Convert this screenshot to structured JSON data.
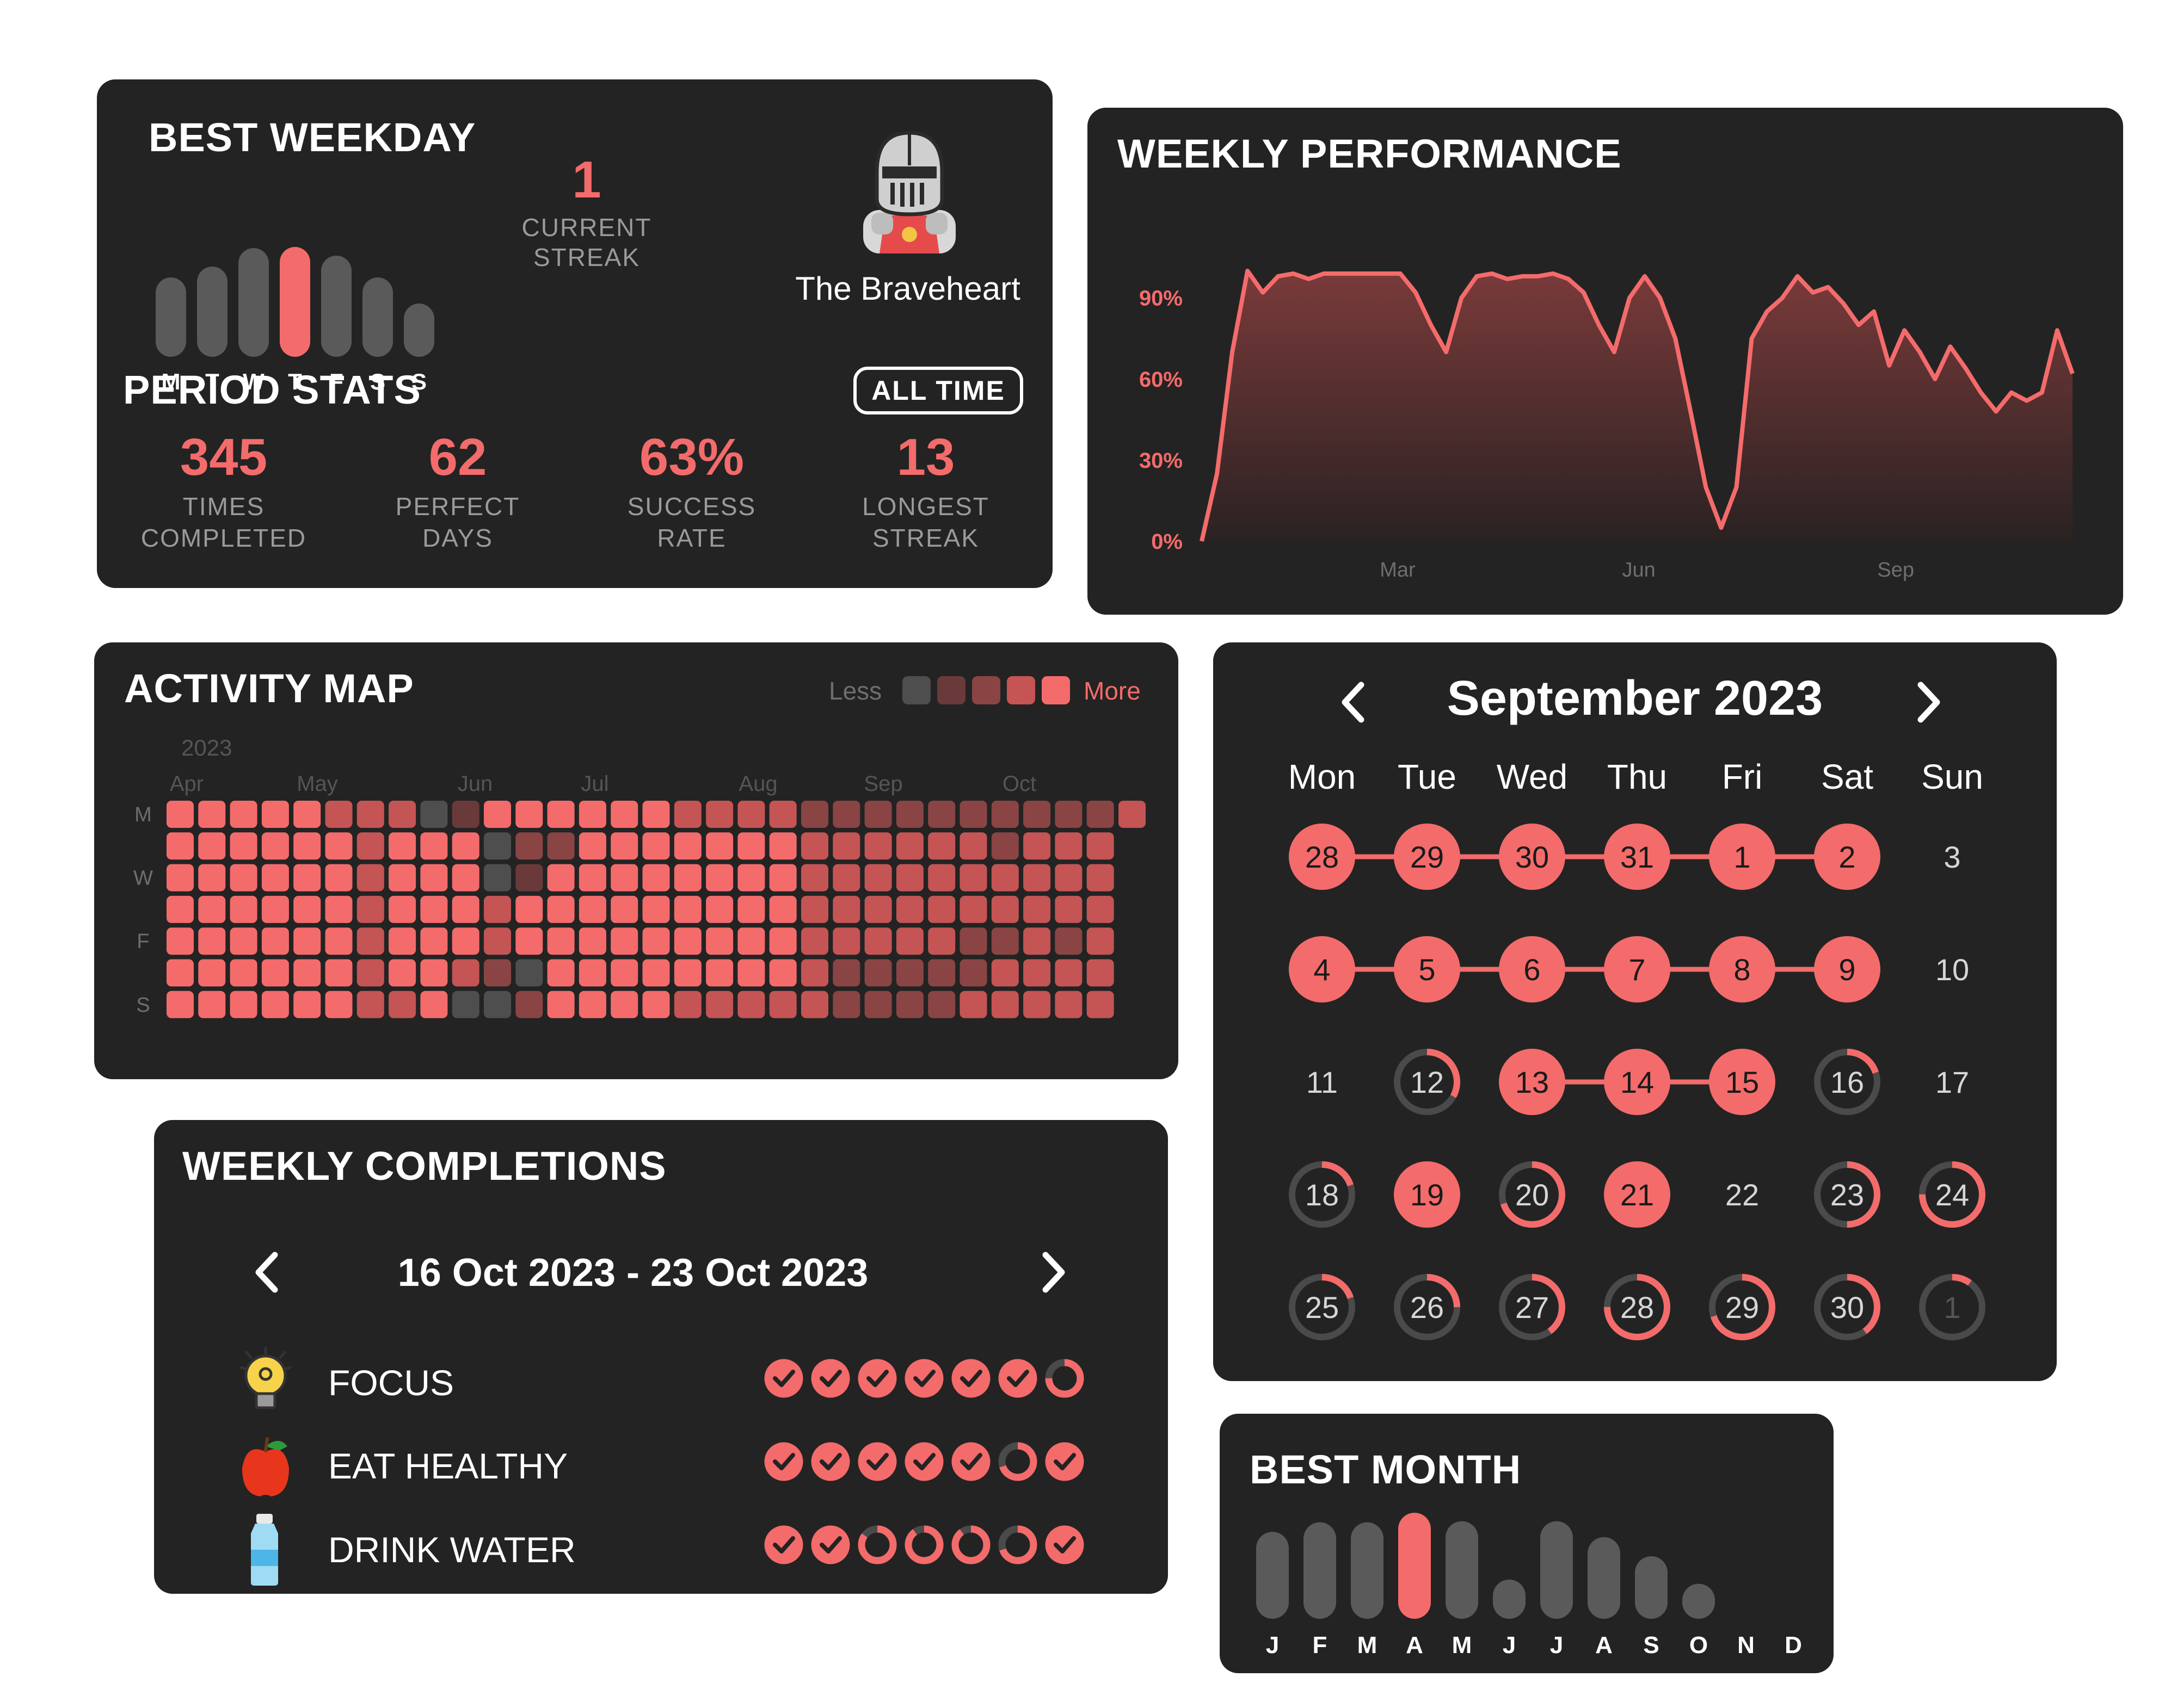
{
  "colors": {
    "accent": "#f46b6b",
    "card": "#232323",
    "bar_gray": "#5a5a5a",
    "muted": "#9a9a9a"
  },
  "best_weekday": {
    "title": "BEST WEEKDAY",
    "days": [
      "M",
      "T",
      "W",
      "T",
      "F",
      "S",
      "S"
    ],
    "values": [
      0.58,
      0.68,
      0.85,
      0.86,
      0.78,
      0.58,
      0.34
    ],
    "best_index": 3
  },
  "streak": {
    "value": "1",
    "label_line1": "CURRENT",
    "label_line2": "STREAK"
  },
  "avatar": {
    "icon": "knight-helmet-icon",
    "name": "The Braveheart"
  },
  "period_stats": {
    "title": "PERIOD STATS",
    "filter": "ALL TIME",
    "stats": [
      {
        "value": "345",
        "line1": "TIMES",
        "line2": "COMPLETED"
      },
      {
        "value": "62",
        "line1": "PERFECT",
        "line2": "DAYS"
      },
      {
        "value": "63%",
        "line1": "SUCCESS",
        "line2": "RATE"
      },
      {
        "value": "13",
        "line1": "LONGEST",
        "line2": "STREAK"
      }
    ]
  },
  "weekly_performance": {
    "title": "WEEKLY PERFORMANCE",
    "chart_data": {
      "type": "area",
      "y_ticks": [
        "90%",
        "60%",
        "30%",
        "0%"
      ],
      "x_ticks": [
        "Mar",
        "Jun",
        "Sep"
      ],
      "ylim": [
        0,
        100
      ],
      "values": [
        0,
        25,
        70,
        100,
        92,
        98,
        99,
        97,
        99,
        99,
        99,
        99,
        99,
        99,
        92,
        80,
        70,
        90,
        98,
        99,
        97,
        98,
        98,
        99,
        97,
        92,
        80,
        70,
        90,
        98,
        90,
        75,
        48,
        20,
        5,
        20,
        75,
        85,
        90,
        98,
        92,
        94,
        88,
        80,
        85,
        65,
        78,
        70,
        60,
        72,
        64,
        55,
        48,
        55,
        52,
        55,
        78,
        62
      ]
    }
  },
  "activity_map": {
    "title": "ACTIVITY MAP",
    "legend_less": "Less",
    "legend_more": "More",
    "year": "2023",
    "months": [
      "Apr",
      "May",
      "Jun",
      "Jul",
      "Aug",
      "Sep",
      "Oct"
    ],
    "day_labels": [
      "M",
      "",
      "W",
      "",
      "F",
      "",
      "S"
    ],
    "rows": [
      "4444433301444444333322222222223",
      "444444344402244444443333332333",
      "444444344401444444443333333333",
      "444444344434444444443333333333",
      "444444344434444444443333322323",
      "444444344320444444443222223333",
      "444444334002444433333222233333"
    ]
  },
  "calendar": {
    "month": "September 2023",
    "weekdays": [
      "Mon",
      "Tue",
      "Wed",
      "Thu",
      "Fri",
      "Sat",
      "Sun"
    ],
    "weeks": [
      [
        {
          "d": "28",
          "p": 1
        },
        {
          "d": "29",
          "p": 1
        },
        {
          "d": "30",
          "p": 1
        },
        {
          "d": "31",
          "p": 1
        },
        {
          "d": "1",
          "p": 1
        },
        {
          "d": "2",
          "p": 1
        },
        {
          "d": "3",
          "p": 0
        }
      ],
      [
        {
          "d": "4",
          "p": 1
        },
        {
          "d": "5",
          "p": 1
        },
        {
          "d": "6",
          "p": 1
        },
        {
          "d": "7",
          "p": 1
        },
        {
          "d": "8",
          "p": 1
        },
        {
          "d": "9",
          "p": 1
        },
        {
          "d": "10",
          "p": 0
        }
      ],
      [
        {
          "d": "11",
          "p": 0
        },
        {
          "d": "12",
          "p": 0.33
        },
        {
          "d": "13",
          "p": 1
        },
        {
          "d": "14",
          "p": 1
        },
        {
          "d": "15",
          "p": 1
        },
        {
          "d": "16",
          "p": 0.2
        },
        {
          "d": "17",
          "p": 0
        }
      ],
      [
        {
          "d": "18",
          "p": 0.2
        },
        {
          "d": "19",
          "p": 1
        },
        {
          "d": "20",
          "p": 0.7
        },
        {
          "d": "21",
          "p": 1
        },
        {
          "d": "22",
          "p": 0
        },
        {
          "d": "23",
          "p": 0.5
        },
        {
          "d": "24",
          "p": 0.75
        }
      ],
      [
        {
          "d": "25",
          "p": 0.2
        },
        {
          "d": "26",
          "p": 0.25
        },
        {
          "d": "27",
          "p": 0.4
        },
        {
          "d": "28",
          "p": 0.75
        },
        {
          "d": "29",
          "p": 0.7
        },
        {
          "d": "30",
          "p": 0.4
        },
        {
          "d": "1",
          "p": 0.1
        }
      ]
    ]
  },
  "weekly_completions": {
    "title": "WEEKLY COMPLETIONS",
    "range": "16 Oct 2023 - 23 Oct 2023",
    "habits": [
      {
        "icon": "lightbulb-icon",
        "name": "FOCUS",
        "days": [
          1,
          1,
          1,
          1,
          1,
          1,
          0.75
        ]
      },
      {
        "icon": "apple-icon",
        "name": "EAT HEALTHY",
        "days": [
          1,
          1,
          1,
          1,
          1,
          0.7,
          1
        ]
      },
      {
        "icon": "water-bottle-icon",
        "name": "DRINK WATER",
        "days": [
          1,
          1,
          0.85,
          0.9,
          0.9,
          0.7,
          1
        ]
      }
    ]
  },
  "best_month": {
    "title": "BEST MONTH",
    "months": [
      "J",
      "F",
      "M",
      "A",
      "M",
      "J",
      "J",
      "A",
      "S",
      "O",
      "N",
      "D"
    ],
    "values": [
      0.82,
      0.91,
      0.91,
      1.0,
      0.92,
      0.37,
      0.92,
      0.77,
      0.59,
      0.33,
      0,
      0
    ],
    "best_index": 3
  }
}
